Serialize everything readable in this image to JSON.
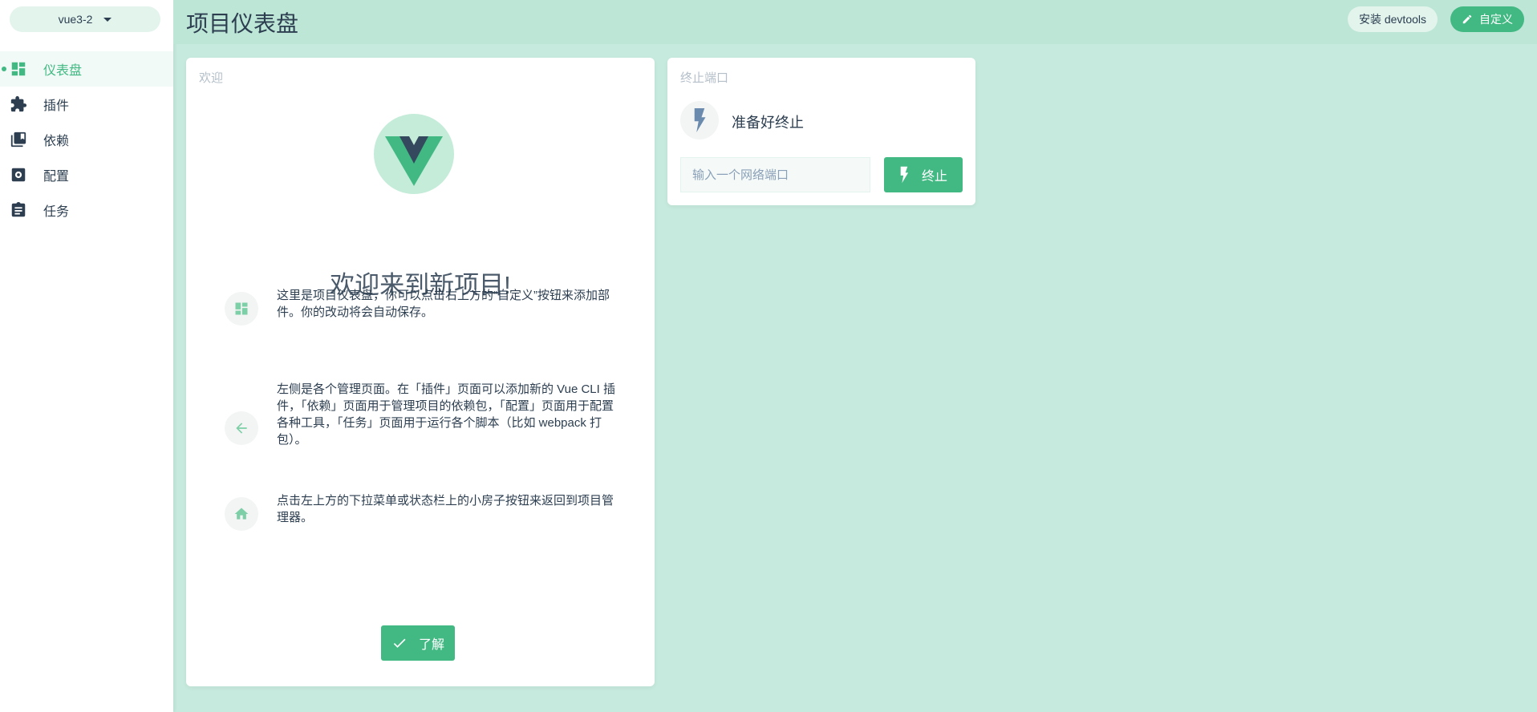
{
  "sidebar": {
    "project": "vue3-2",
    "items": [
      {
        "label": "仪表盘",
        "icon": "dashboard-icon"
      },
      {
        "label": "插件",
        "icon": "puzzle-icon"
      },
      {
        "label": "依赖",
        "icon": "library-icon"
      },
      {
        "label": "配置",
        "icon": "settings-icon"
      },
      {
        "label": "任务",
        "icon": "clipboard-icon"
      }
    ]
  },
  "header": {
    "title": "项目仪表盘",
    "devtools_label": "安装 devtools",
    "customize_label": "自定义"
  },
  "welcome": {
    "card_title": "欢迎",
    "title": "欢迎来到新项目!",
    "tips": [
      "这里是项目仪表盘，你可以点击右上方的“自定义”按钮来添加部件。你的改动将会自动保存。",
      "左侧是各个管理页面。在「插件」页面可以添加新的 Vue CLI 插件，「依赖」页面用于管理项目的依赖包，「配置」页面用于配置各种工具，「任务」页面用于运行各个脚本（比如 webpack 打包）。",
      "点击左上方的下拉菜单或状态栏上的小房子按钮来返回到项目管理器。"
    ],
    "ok_label": "了解"
  },
  "kill_port": {
    "card_title": "终止端口",
    "status": "准备好终止",
    "input_placeholder": "输入一个网络端口",
    "input_value": "",
    "button_label": "终止"
  },
  "colors": {
    "accent": "#42b983",
    "text": "#2c3e50",
    "background": "#c6eadd"
  }
}
